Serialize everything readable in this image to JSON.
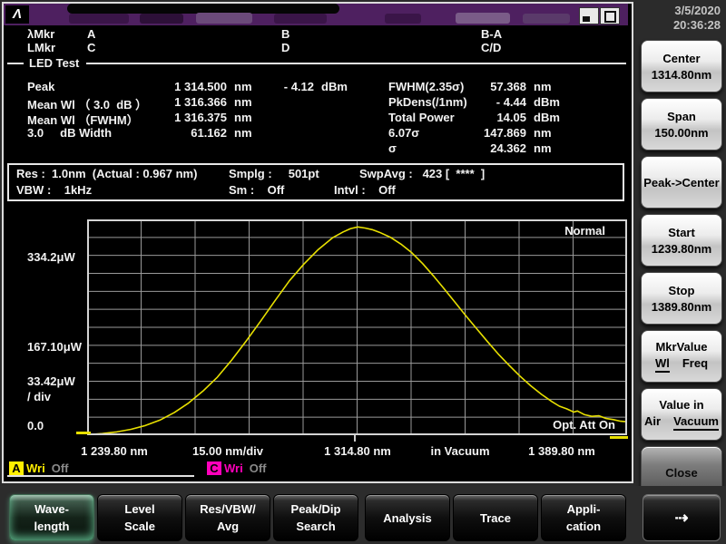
{
  "colors": {
    "trace_a": "#e8e000",
    "trace_c": "#ff00bb",
    "titlebar": "#4e2060",
    "grid": "#9a9a9a"
  },
  "titlebar": {
    "logo_glyph": "Λ"
  },
  "clock": {
    "date": "3/5/2020",
    "time": "20:36:28"
  },
  "markers": {
    "row1": {
      "label": "λMkr",
      "c1": "A",
      "c2": "B",
      "c3": "B-A"
    },
    "row2": {
      "label": "LMkr",
      "c1": "C",
      "c2": "D",
      "c3": "C/D"
    }
  },
  "section_title": "LED Test",
  "measurements": {
    "left": [
      {
        "label": "Peak",
        "value": "1 314.500",
        "unit": "nm",
        "value2": "- 4.12",
        "unit2": "dBm"
      },
      {
        "label": "Mean Wl （ 3.0  dB ）",
        "value": "1 316.366",
        "unit": "nm"
      },
      {
        "label": "Mean Wl （FWHM）",
        "value": "1 316.375",
        "unit": "nm"
      },
      {
        "label": "3.0     dB Width",
        "value": "61.162",
        "unit": "nm"
      }
    ],
    "right": [
      {
        "label": "FWHM(2.35σ)",
        "value": "57.368",
        "unit": "nm"
      },
      {
        "label": "PkDens(/1nm)",
        "value": "- 4.44",
        "unit": "dBm"
      },
      {
        "label": "Total Power",
        "value": "14.05",
        "unit": "dBm"
      },
      {
        "label": "6.07σ",
        "value": "147.869",
        "unit": "nm"
      },
      {
        "label": "σ",
        "value": "24.362",
        "unit": "nm"
      }
    ]
  },
  "settings": {
    "line1_res": "Res :  1.0nm  (Actual : 0.967 nm)",
    "line1_smplg": "Smplg :     501pt",
    "line1_swpavg": "SwpAvg :   423 [  ****  ]",
    "line2_vbw": "VBW :    1kHz",
    "line2_sm": "Sm :    Off",
    "line2_intvl": "Intvl :    Off"
  },
  "chart_data": {
    "type": "line",
    "title": "LED spectrum trace A",
    "x_range_nm": [
      1239.8,
      1389.8
    ],
    "x_per_div_nm": 15.0,
    "ylim_uW": [
      0,
      401.0
    ],
    "y_per_div_uW": 33.42,
    "grid": {
      "cols": 10,
      "rows": 12,
      "on": true
    },
    "y_axis": {
      "top_label": "334.2μW",
      "mid_label": "167.10μW",
      "per_div_label": "33.42μW",
      "per_div_label2": "/ div",
      "zero_label": "0.0"
    },
    "x_axis": {
      "start_label": "1 239.80 nm",
      "per_div_label": "15.00 nm/div",
      "center_label": "1 314.80 nm",
      "medium_label": "in Vacuum",
      "stop_label": "1 389.80 nm"
    },
    "annotations": {
      "mode": "Normal",
      "opt_att": "Opt. Att On"
    },
    "series": [
      {
        "name": "Trace A",
        "color": "#e8e000",
        "x_nm": [
          1239.8,
          1244,
          1248,
          1252,
          1256,
          1260,
          1264,
          1268,
          1272,
          1276,
          1280,
          1284,
          1288,
          1292,
          1296,
          1300,
          1304,
          1308,
          1311,
          1313,
          1315,
          1317,
          1319,
          1321,
          1324,
          1327,
          1330,
          1333,
          1336,
          1339,
          1342,
          1345,
          1348,
          1351,
          1354,
          1357,
          1360,
          1363,
          1366,
          1369,
          1371,
          1373,
          1375,
          1376,
          1378,
          1380,
          1382,
          1384,
          1386,
          1388,
          1389.8
        ],
        "p_uW": [
          1,
          3,
          6,
          11,
          18,
          28,
          42,
          60,
          82,
          108,
          140,
          175,
          212,
          250,
          287,
          318,
          345,
          367,
          378,
          384,
          387,
          385,
          382,
          377,
          368,
          355,
          339,
          319,
          296,
          272,
          247,
          222,
          198,
          174,
          151,
          130,
          110,
          92,
          76,
          62,
          54,
          49,
          43,
          45,
          38,
          35,
          36,
          31,
          29,
          26,
          25
        ]
      }
    ]
  },
  "trace_legend": [
    {
      "trace": "A",
      "state": "Wri",
      "status": "Off",
      "color": "#ffee00",
      "active": true
    },
    {
      "trace": "C",
      "state": "Wri",
      "status": "Off",
      "color": "#ff00bb",
      "active": false
    }
  ],
  "side_buttons": {
    "center": {
      "label": "Center",
      "value": "1314.80nm"
    },
    "span": {
      "label": "Span",
      "value": "150.00nm"
    },
    "peak_center": {
      "label": "Peak->Center"
    },
    "start": {
      "label": "Start",
      "value": "1239.80nm"
    },
    "stop": {
      "label": "Stop",
      "value": "1389.80nm"
    },
    "mkr_value": {
      "label": "MkrValue",
      "opt1": "Wl",
      "opt2": "Freq",
      "selected": "Wl"
    },
    "value_in": {
      "label": "Value in",
      "opt1": "Air",
      "opt2": "Vacuum",
      "selected": "Vacuum"
    },
    "close": {
      "label": "Close"
    }
  },
  "bottom_tabs": [
    {
      "line1": "Wave-",
      "line2": "length",
      "active": true
    },
    {
      "line1": "Level",
      "line2": "Scale"
    },
    {
      "line1": "Res/VBW/",
      "line2": "Avg"
    },
    {
      "line1": "Peak/Dip",
      "line2": "Search"
    },
    {
      "line1": "Analysis"
    },
    {
      "line1": "Trace"
    },
    {
      "line1": "Appli-",
      "line2": "cation"
    },
    {
      "line1": "⇢",
      "arrow": true
    }
  ]
}
